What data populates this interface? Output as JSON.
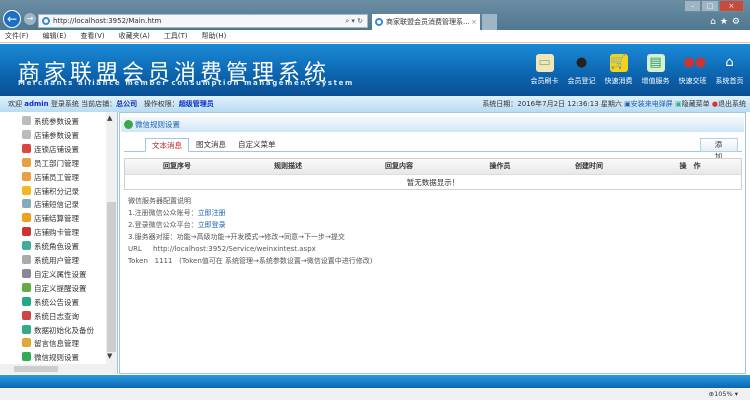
{
  "browser": {
    "url": "http://localhost:3952/Main.htm",
    "tab_title": "商家联盟会员消费管理系...",
    "menu": [
      "文件(F)",
      "编辑(E)",
      "查看(V)",
      "收藏夹(A)",
      "工具(T)",
      "帮助(H)"
    ],
    "zoom": "105%"
  },
  "header": {
    "title": "商家联盟会员消费管理系统",
    "subtitle": "Merchants alliance member consumption management system",
    "quick": [
      {
        "label": "会员刷卡",
        "icon": "card-icon"
      },
      {
        "label": "会员登记",
        "icon": "user-icon"
      },
      {
        "label": "快速消费",
        "icon": "cart-icon"
      },
      {
        "label": "增值服务",
        "icon": "clipboard-icon"
      },
      {
        "label": "快速交班",
        "icon": "users-icon"
      },
      {
        "label": "系统首页",
        "icon": "home-icon"
      }
    ]
  },
  "info": {
    "welcome": "欢迎",
    "user": "admin",
    "login_text": "登录系统",
    "store_label": "当前店铺：",
    "store": "总公司",
    "perm_label": "操作权限：",
    "perm": "超级管理员",
    "date_label": "系统日期：",
    "date": "2016年7月2日 12:36:13 星期六",
    "install": "安装来电弹屏",
    "hide_menu": "隐藏菜单",
    "logout": "退出系统"
  },
  "sidebar": {
    "items": [
      "系统参数设置",
      "店铺参数设置",
      "连锁店铺设置",
      "员工部门管理",
      "店铺员工管理",
      "店铺积分记录",
      "店铺短信记录",
      "店铺结算管理",
      "店铺购卡管理",
      "系统角色设置",
      "系统用户管理",
      "自定义属性设置",
      "自定义提醒设置",
      "系统公告设置",
      "系统日志查询",
      "数据初始化及备份",
      "留言信息管理",
      "微信规则设置"
    ]
  },
  "main": {
    "panel_title": "微信规则设置",
    "tabs": [
      "文本消息",
      "图文消息",
      "自定义菜单"
    ],
    "add_label": "添 加",
    "columns": [
      "回复序号",
      "规则描述",
      "回复内容",
      "操作员",
      "创建时间",
      "操　作"
    ],
    "empty": "暂无数据显示！",
    "notes": {
      "heading": "微信服务器配置说明",
      "step1": "1.注册微信公众账号：",
      "step1_link": "立即注册",
      "step2": "2.登录微信公众平台：",
      "step2_link": "立即登录",
      "step3": "3.服务器对接：功能→高级功能→开发模式→修改→同意→下一步→提交",
      "url_label": "URL",
      "url": "http://localhost:3952/Service/weinxintest.aspx",
      "token_label": "Token",
      "token": "1111",
      "token_note": "(Token值可在 系统管理→系统参数设置→微信设置中进行修改)"
    }
  }
}
